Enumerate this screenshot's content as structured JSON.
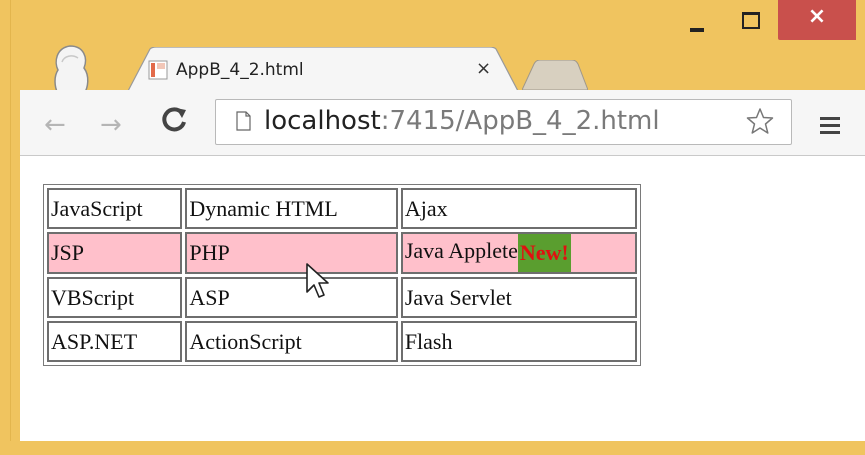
{
  "window": {
    "frame_color": "#f0c45f",
    "close_color": "#c9504c",
    "minimize_label": "",
    "close_label": "×"
  },
  "tab": {
    "title": "AppB_4_2.html",
    "close_label": "×"
  },
  "toolbar": {
    "url_host": "localhost",
    "url_rest": ":7415/AppB_4_2.html"
  },
  "table": {
    "rows": [
      [
        "JavaScript",
        "Dynamic HTML",
        "Ajax"
      ],
      [
        "JSP",
        "PHP",
        "Java Applete"
      ],
      [
        "VBScript",
        "ASP",
        "Java Servlet"
      ],
      [
        "ASP.NET",
        "ActionScript",
        "Flash"
      ]
    ],
    "badge": "New!",
    "highlight_color": "#ffc0cb",
    "badge_bg": "#5a9e2f",
    "badge_color": "#e01010"
  }
}
